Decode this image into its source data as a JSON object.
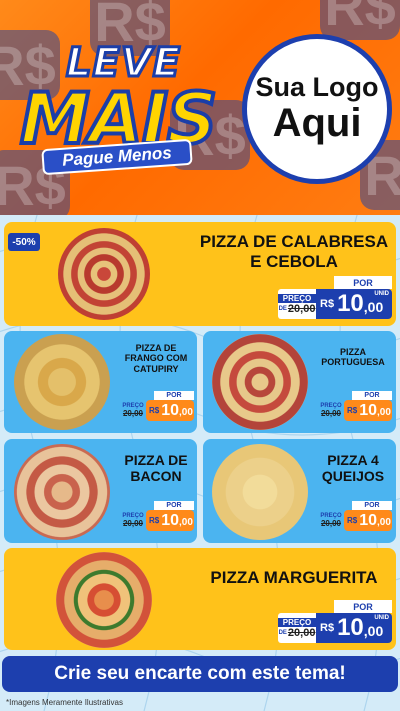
{
  "header": {
    "leve": "LEVE",
    "mais": "MAIS",
    "pague_menos": "Pague Menos",
    "logo_line1": "Sua Logo",
    "logo_line2": "Aqui",
    "bg_glyph": "R$"
  },
  "badge": "-50%",
  "products": [
    {
      "name_line1": "PIZZA DE CALABRESA",
      "name_line2": "E CEBOLA",
      "por": "POR",
      "preco": "PREÇO",
      "de": "DE",
      "old": "20,00",
      "rs": "R$",
      "int": "10",
      "dec": ",00",
      "unid": "UNID"
    },
    {
      "name_line1": "PIZZA DE",
      "name_line2": "FRANGO COM",
      "name_line3": "CATUPIRY",
      "por": "POR",
      "preco": "PREÇO",
      "old": "20,00",
      "rs": "R$",
      "int": "10",
      "dec": ",00"
    },
    {
      "name_line1": "PIZZA",
      "name_line2": "PORTUGUESA",
      "por": "POR",
      "preco": "PREÇO",
      "old": "20,00",
      "rs": "R$",
      "int": "10",
      "dec": ",00"
    },
    {
      "name_line1": "PIZZA DE",
      "name_line2": "BACON",
      "por": "POR",
      "preco": "PREÇO",
      "old": "20,00",
      "rs": "R$",
      "int": "10",
      "dec": ",00"
    },
    {
      "name_line1": "PIZZA 4",
      "name_line2": "QUEIJOS",
      "por": "POR",
      "preco": "PREÇO",
      "old": "20,00",
      "rs": "R$",
      "int": "10",
      "dec": ",00"
    },
    {
      "name_line1": "PIZZA MARGUERITA",
      "por": "POR",
      "preco": "PREÇO",
      "de": "DE",
      "old": "20,00",
      "rs": "R$",
      "int": "10",
      "dec": ",00",
      "unid": "UNID"
    }
  ],
  "cta": "Crie seu encarte com este tema!",
  "disclaimer": "*Imagens Meramente Ilustrativas",
  "colors": {
    "orange": "#ff7a10",
    "navy": "#1d3fae",
    "yellow": "#ffc21a",
    "sky": "#4bb4f0",
    "bg": "#d4ebf8"
  }
}
